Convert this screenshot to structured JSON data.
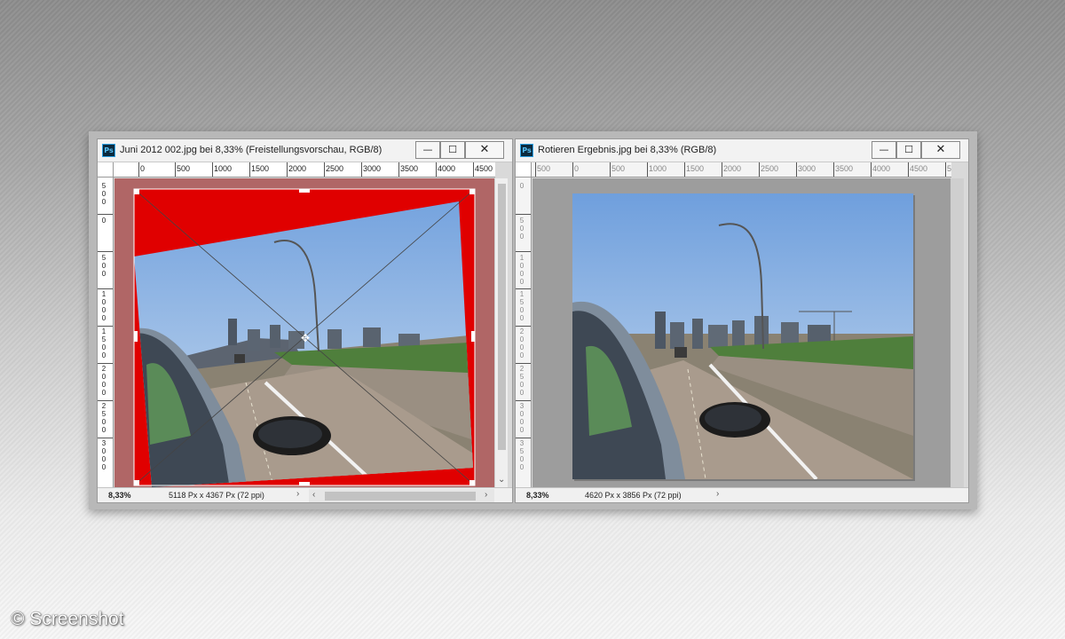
{
  "left_window": {
    "title": "Juni 2012 002.jpg bei 8,33%  (Freistellungsvorschau, RGB/8)",
    "app_icon": "Ps",
    "ruler_h": [
      "0",
      "500",
      "1000",
      "1500",
      "2000",
      "2500",
      "3000",
      "3500",
      "4000",
      "4500"
    ],
    "ruler_v": [
      "500",
      "0",
      "500",
      "1000",
      "1500",
      "2000",
      "2500",
      "3000"
    ],
    "status_zoom": "8,33%",
    "status_doc": "5118 Px x 4367 Px (72 ppi)",
    "status_arrow": "›",
    "btn_min": "—",
    "btn_max": "☐",
    "btn_close": "✕"
  },
  "right_window": {
    "title": "Rotieren Ergebnis.jpg bei 8,33% (RGB/8)",
    "app_icon": "Ps",
    "ruler_h": [
      "500",
      "0",
      "500",
      "1000",
      "1500",
      "2000",
      "2500",
      "3000",
      "3500",
      "4000",
      "4500",
      "5"
    ],
    "ruler_v": [
      "0",
      "500",
      "1000",
      "1500",
      "2000",
      "2500",
      "3000",
      "3500"
    ],
    "status_zoom": "8,33%",
    "status_doc": "4620 Px x 3856 Px (72 ppi)",
    "status_arrow": "›",
    "btn_min": "—",
    "btn_max": "☐",
    "btn_close": "✕"
  },
  "watermark": "© Screenshot",
  "colors": {
    "crop_fill": "#e00000",
    "outside_overlay": "#b06666",
    "sky": "#8fb3e0",
    "road": "#a89a8c"
  }
}
